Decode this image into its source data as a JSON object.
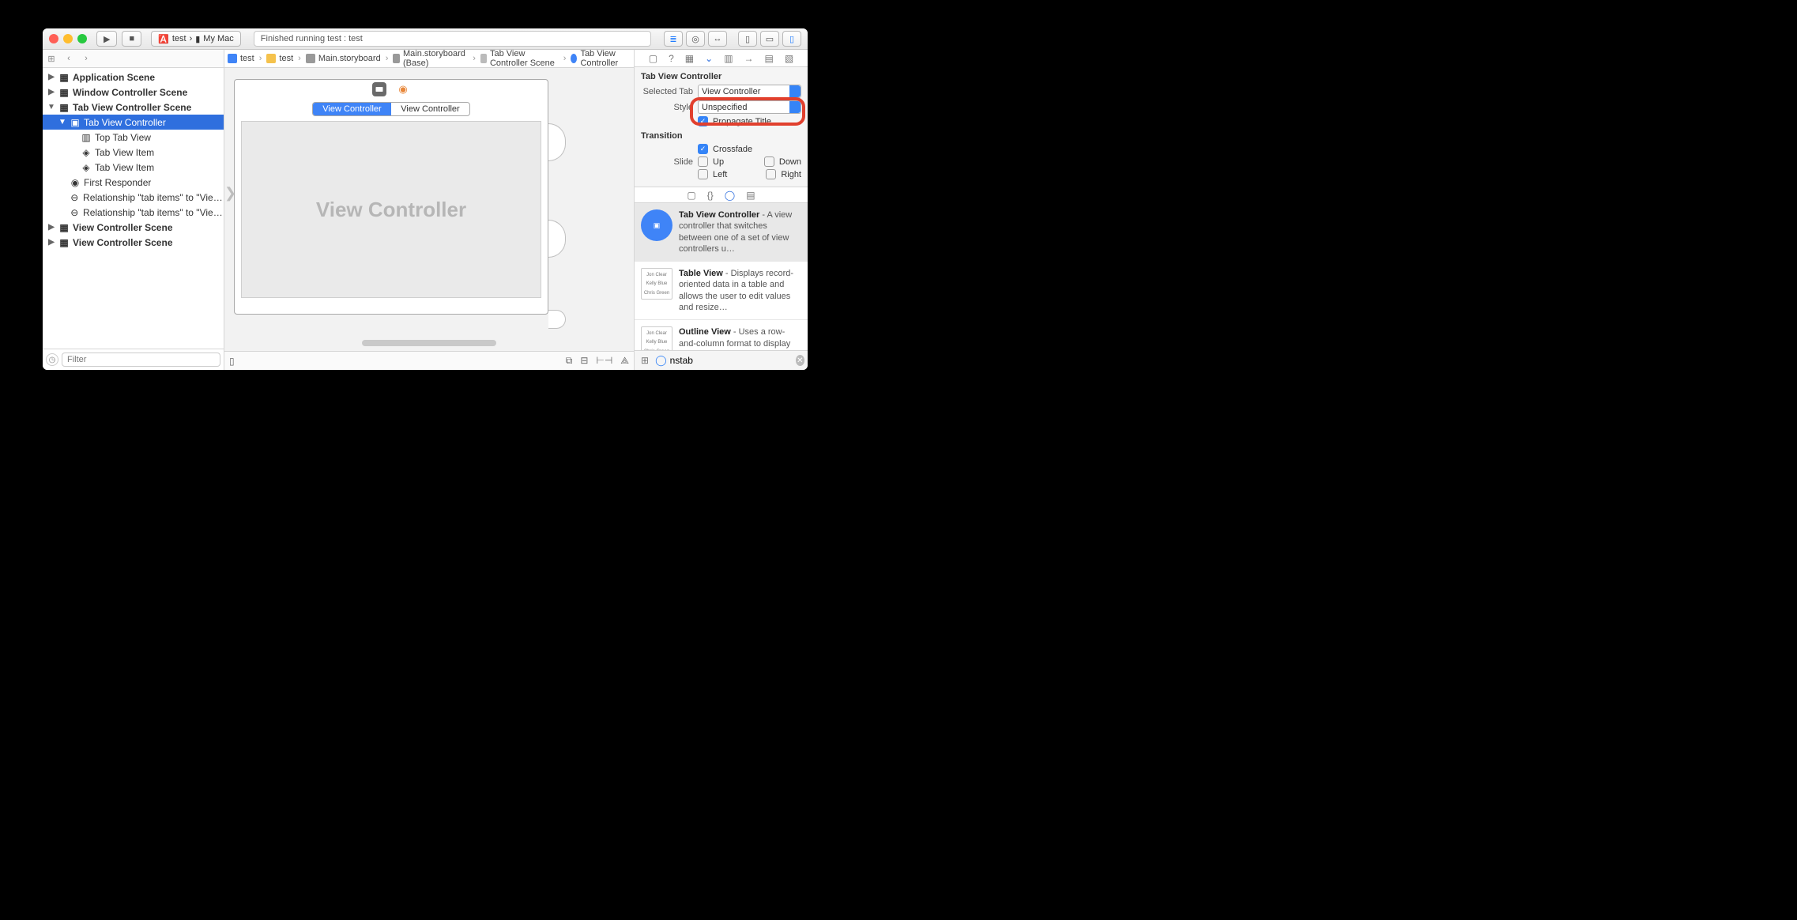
{
  "titlebar": {
    "scheme_target": "test",
    "scheme_device": "My Mac",
    "status": "Finished running test : test"
  },
  "breadcrumbs": [
    "test",
    "test",
    "Main.storyboard",
    "Main.storyboard (Base)",
    "Tab View Controller Scene",
    "Tab View Controller"
  ],
  "outline": {
    "items": [
      {
        "label": "Application Scene",
        "depth": 0,
        "disc": "▶",
        "heavy": true,
        "icon": "scene"
      },
      {
        "label": "Window Controller Scene",
        "depth": 0,
        "disc": "▶",
        "heavy": true,
        "icon": "scene"
      },
      {
        "label": "Tab View Controller Scene",
        "depth": 0,
        "disc": "▼",
        "heavy": true,
        "icon": "scene"
      },
      {
        "label": "Tab View Controller",
        "depth": 1,
        "disc": "▼",
        "heavy": false,
        "icon": "vc",
        "sel": true
      },
      {
        "label": "Top Tab View",
        "depth": 2,
        "disc": "",
        "heavy": false,
        "icon": "tabview"
      },
      {
        "label": "Tab View Item",
        "depth": 2,
        "disc": "",
        "heavy": false,
        "icon": "cube"
      },
      {
        "label": "Tab View Item",
        "depth": 2,
        "disc": "",
        "heavy": false,
        "icon": "cube"
      },
      {
        "label": "First Responder",
        "depth": 1,
        "disc": "",
        "heavy": false,
        "icon": "responder"
      },
      {
        "label": "Relationship \"tab items\" to \"View…",
        "depth": 1,
        "disc": "",
        "heavy": false,
        "icon": "rel"
      },
      {
        "label": "Relationship \"tab items\" to \"View…",
        "depth": 1,
        "disc": "",
        "heavy": false,
        "icon": "rel"
      },
      {
        "label": "View Controller Scene",
        "depth": 0,
        "disc": "▶",
        "heavy": true,
        "icon": "scene"
      },
      {
        "label": "View Controller Scene",
        "depth": 0,
        "disc": "▶",
        "heavy": true,
        "icon": "scene"
      }
    ],
    "filter_placeholder": "Filter"
  },
  "canvas": {
    "tab1": "View Controller",
    "tab2": "View Controller",
    "content_placeholder": "View Controller"
  },
  "inspector": {
    "header": "Tab View Controller",
    "selected_tab_label": "Selected Tab",
    "selected_tab_value": "View Controller",
    "style_label": "Style",
    "style_value": "Unspecified",
    "propagate_label": "Propagate Title",
    "transition_header": "Transition",
    "crossfade": "Crossfade",
    "slide_label": "Slide",
    "up": "Up",
    "down": "Down",
    "left": "Left",
    "right": "Right"
  },
  "library": {
    "items": [
      {
        "title": "Tab View Controller",
        "desc": " - A view controller that switches between one of a set of view controllers u…",
        "icon": "blue",
        "sel": true
      },
      {
        "title": "Table View",
        "desc": " - Displays record-oriented data in a table and allows the user to edit values and resize…",
        "icon": "tbl"
      },
      {
        "title": "Outline View",
        "desc": " - Uses a row-and-column format to display hierarchical data that can be exp…",
        "icon": "tbl"
      }
    ],
    "filter_value": "nstab"
  }
}
